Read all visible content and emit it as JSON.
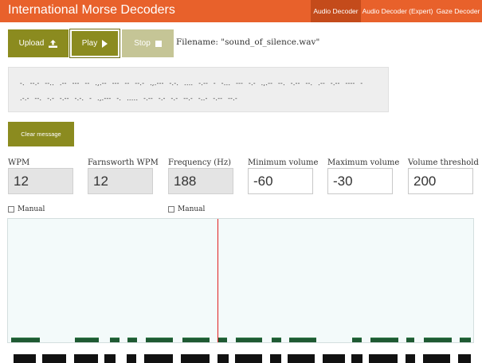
{
  "header": {
    "title": "International Morse Decoders",
    "tabs": [
      {
        "label": "Audio Decoder",
        "active": true
      },
      {
        "label": "Audio Decoder (Expert)",
        "active": false
      },
      {
        "label": "Gaze Decoder",
        "active": false
      }
    ]
  },
  "toolbar": {
    "upload_label": "Upload",
    "play_label": "Play",
    "stop_label": "Stop",
    "filename": "Filename: \"sound_of_silence.wav\""
  },
  "message": {
    "text": "-. --.- --.. .-- --- -- .,.-- --- -- --.- .,.--- -.-. .... -.-- - -... --- -.- .,.-- --. -.-- --. .-- -.-- ---- - .-.- --. -.- -.-- -.-. - .,.--- -. ..... -.-- -.- -.- --.- -..- -.-- --.-"
  },
  "clear_label": "Clear message",
  "fields": {
    "wpm": {
      "label": "WPM",
      "value": "12"
    },
    "farnsworth": {
      "label": "Farnsworth WPM",
      "value": "12"
    },
    "frequency": {
      "label": "Frequency (Hz)",
      "value": "188"
    },
    "min_volume": {
      "label": "Minimum volume",
      "value": "-60"
    },
    "max_volume": {
      "label": "Maximum volume",
      "value": "-30"
    },
    "threshold": {
      "label": "Volume threshold",
      "value": "200"
    }
  },
  "manual": {
    "wpm_label": "Manual",
    "frequency_label": "Manual"
  },
  "colors": {
    "header_bg": "#e8612b",
    "active_tab_bg": "#c44b1b",
    "button_olive": "#8b8b1f",
    "button_disabled": "#c5c596",
    "signal_bar": "#1f5a33",
    "cursor_line": "#e02020"
  }
}
